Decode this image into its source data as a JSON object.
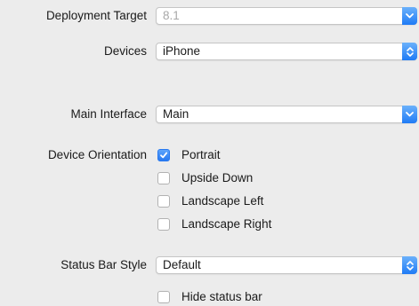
{
  "deployment_target": {
    "label": "Deployment Target",
    "value": "8.1"
  },
  "devices": {
    "label": "Devices",
    "value": "iPhone"
  },
  "main_interface": {
    "label": "Main Interface",
    "value": "Main"
  },
  "device_orientation": {
    "label": "Device Orientation",
    "options": [
      {
        "label": "Portrait",
        "checked": true
      },
      {
        "label": "Upside Down",
        "checked": false
      },
      {
        "label": "Landscape Left",
        "checked": false
      },
      {
        "label": "Landscape Right",
        "checked": false
      }
    ]
  },
  "status_bar_style": {
    "label": "Status Bar Style",
    "value": "Default"
  },
  "hide_status_bar": {
    "label": "Hide status bar",
    "checked": false
  },
  "colors": {
    "accent": "#1f7bf5",
    "background": "#ececec"
  },
  "icons": {
    "combo_arrow": "chevron-down-icon",
    "popup_arrows": "up-down-arrows-icon",
    "check": "checkmark-icon"
  }
}
